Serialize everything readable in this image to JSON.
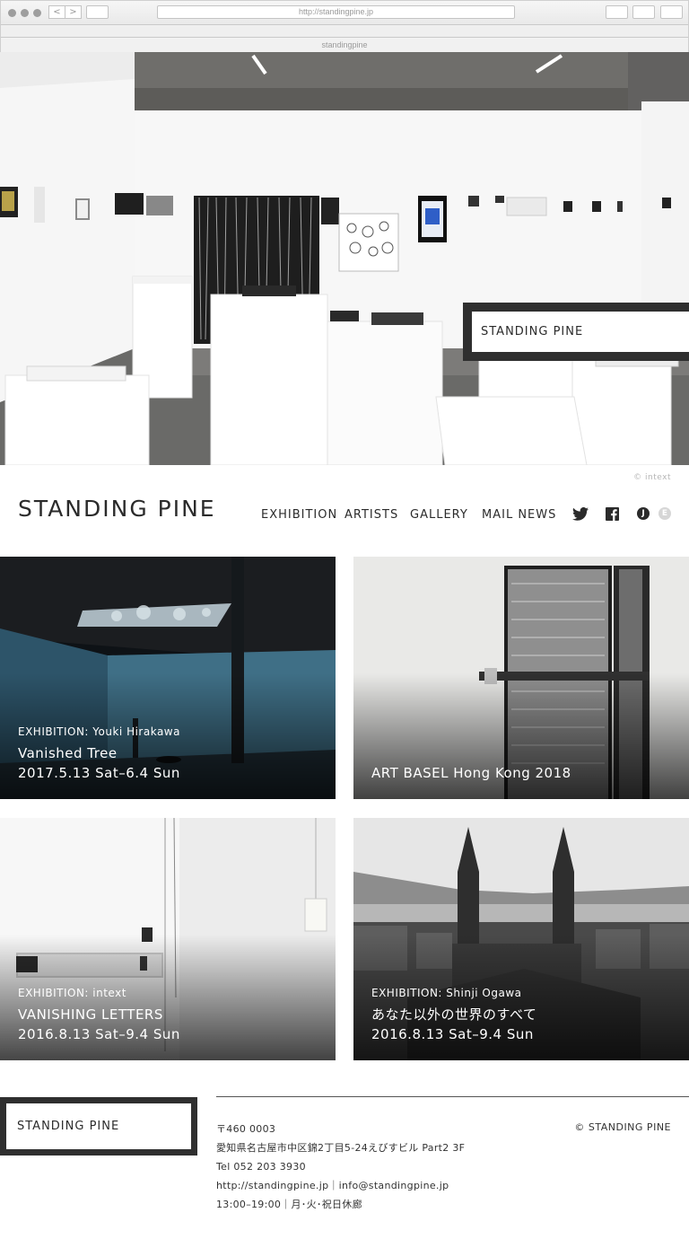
{
  "browser": {
    "url": "http://standingpine.jp",
    "tab_title": "standingpine",
    "back": "<",
    "forward": ">"
  },
  "hero": {
    "badge_text": "STANDING PINE",
    "credit": "© intext"
  },
  "header": {
    "logo": "STANDING PINE",
    "nav": [
      "EXHIBITION",
      "ARTISTS",
      "GALLERY",
      "MAIL NEWS"
    ],
    "lang": [
      "J",
      "E"
    ]
  },
  "tiles": [
    {
      "category": "EXHIBITION: Youki Hirakawa",
      "title": "Vanished Tree",
      "date": "2017.5.13 Sat–6.4 Sun"
    },
    {
      "category": "",
      "title": "ART BASEL Hong Kong 2018",
      "date": ""
    },
    {
      "category": "EXHIBITION: intext",
      "title": "VANISHING LETTERS",
      "date": "2016.8.13 Sat–9.4 Sun"
    },
    {
      "category": "EXHIBITION: Shinji Ogawa",
      "title": "あなた以外の世界のすべて",
      "date": "2016.8.13 Sat–9.4 Sun"
    }
  ],
  "footer": {
    "logo": "STANDING PINE",
    "address_lines": [
      "〒460 0003",
      "愛知県名古屋市中区錦2丁目5-24えびすビル Part2 3F",
      "Tel 052 203 3930",
      "http://standingpine.jp｜info@standingpine.jp",
      "13:00–19:00｜月･火･祝日休廊"
    ],
    "copyright": "© STANDING PINE"
  }
}
